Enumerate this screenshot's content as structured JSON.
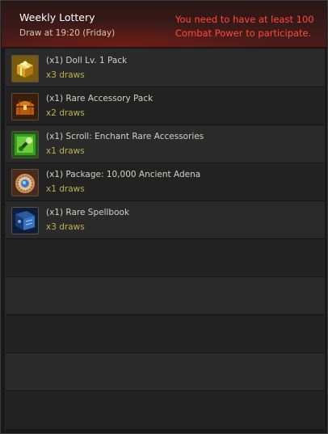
{
  "header": {
    "title": "Weekly Lottery",
    "draw_time": "Draw at 19:20 (Friday)",
    "warning": "You need to have at least 100 Combat Power to participate."
  },
  "items": [
    {
      "name": "(x1) Doll Lv. 1 Pack",
      "draws": "x3 draws",
      "icon": "gold-gift-box-icon"
    },
    {
      "name": "(x1) Rare Accessory Pack",
      "draws": "x2 draws",
      "icon": "treasure-chest-icon"
    },
    {
      "name": "(x1) Scroll: Enchant Rare Accessories",
      "draws": "x1 draws",
      "icon": "enchant-scroll-icon"
    },
    {
      "name": "(x1) Package: 10,000 Ancient Adena",
      "draws": "x1 draws",
      "icon": "adena-coin-pouch-icon"
    },
    {
      "name": "(x1) Rare Spellbook",
      "draws": "x3 draws",
      "icon": "spellbook-icon"
    }
  ],
  "colors": {
    "warning": "#ff4a3a",
    "draws": "#bfb24f",
    "item_text": "#d4d0c8",
    "header_bg": "#3a1a18"
  }
}
